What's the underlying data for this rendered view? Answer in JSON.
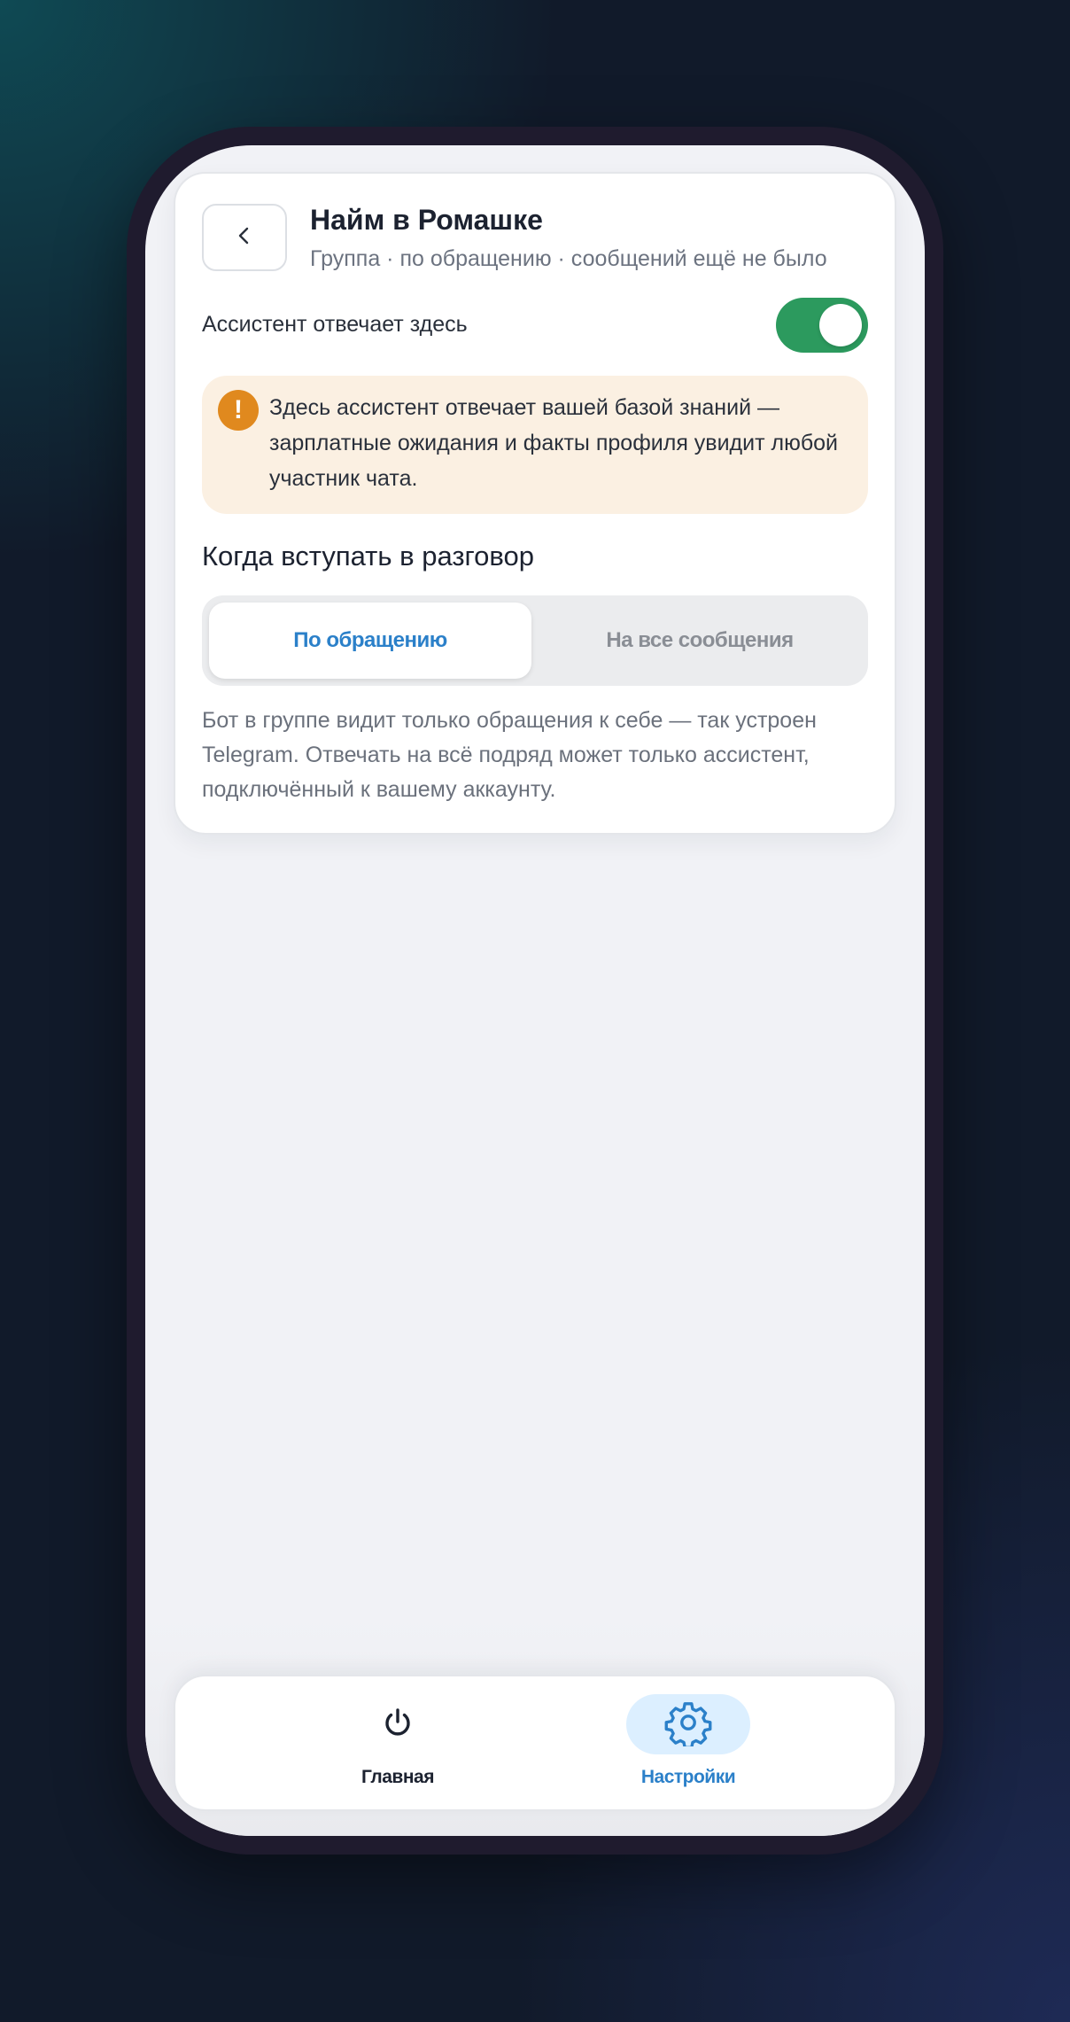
{
  "header": {
    "title": "Найм в Ромашке",
    "subtitle": "Группа · по обращению · сообщений ещё не было",
    "back_icon": "chevron-left-icon"
  },
  "assistant_toggle": {
    "label": "Ассистент отвечает здесь",
    "enabled": true,
    "color": "#2c9a5e"
  },
  "warning": {
    "icon": "exclamation-icon",
    "text": "Здесь ассистент отвечает вашей базой знаний — зарплатные ожидания и факты профиля увидит любой участник чата.",
    "bg_color": "#fbf0e2",
    "icon_color": "#e0891e"
  },
  "mode": {
    "title": "Когда вступать в разговор",
    "options": [
      {
        "label": "По обращению",
        "selected": true
      },
      {
        "label": "На все сообщения",
        "selected": false
      }
    ],
    "description": "Бот в группе видит только обращения к себе — так устроен Telegram. Отвечать на всё подряд может только ассистент, подключённый к вашему аккаунту."
  },
  "bottom_nav": {
    "items": [
      {
        "label": "Главная",
        "icon": "power-icon",
        "active": false
      },
      {
        "label": "Настройки",
        "icon": "gear-icon",
        "active": true
      }
    ],
    "accent": "#2b80c9"
  }
}
